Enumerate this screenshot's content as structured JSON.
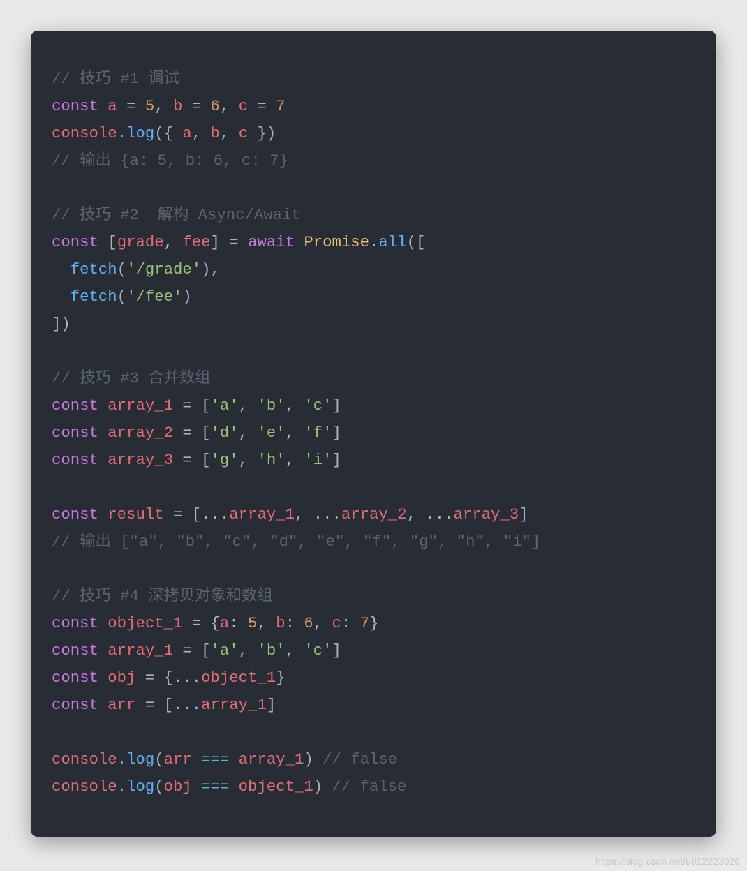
{
  "watermark": "https://blog.csdn.net/u012223026",
  "tokens": {
    "c1": "// 技巧 #1 调试",
    "const": "const",
    "a": "a",
    "eq": " = ",
    "n5": "5",
    "comma": ", ",
    "b": "b",
    "n6": "6",
    "c": "c",
    "n7": "7",
    "console": "console",
    "dot": ".",
    "log": "log",
    "lp": "(",
    "rp": ")",
    "lb": "{",
    "rb": "}",
    "sp": " ",
    "out1": "// 输出 {a: 5, b: 6, c: 7}",
    "c2": "// 技巧 #2  解构 Async/Await",
    "lbr": "[",
    "rbr": "]",
    "grade": "grade",
    "fee": "fee",
    "await": "await",
    "Promise": "Promise",
    "all": "all",
    "fetch": "fetch",
    "sgrade": "'/grade'",
    "sfee": "'/fee'",
    "c3": "// 技巧 #3 合并数组",
    "array_1": "array_1",
    "array_2": "array_2",
    "array_3": "array_3",
    "sa": "'a'",
    "sb": "'b'",
    "sc": "'c'",
    "sd": "'d'",
    "se": "'e'",
    "sf": "'f'",
    "sg": "'g'",
    "sh": "'h'",
    "si": "'i'",
    "result": "result",
    "spread": "...",
    "out3": "// 输出 [\"a\", \"b\", \"c\", \"d\", \"e\", \"f\", \"g\", \"h\", \"i\"]",
    "c4": "// 技巧 #4 深拷贝对象和数组",
    "object_1": "object_1",
    "colon": ": ",
    "obj": "obj",
    "arr": "arr",
    "eqeqeq": " === ",
    "cfalse": " // false"
  }
}
